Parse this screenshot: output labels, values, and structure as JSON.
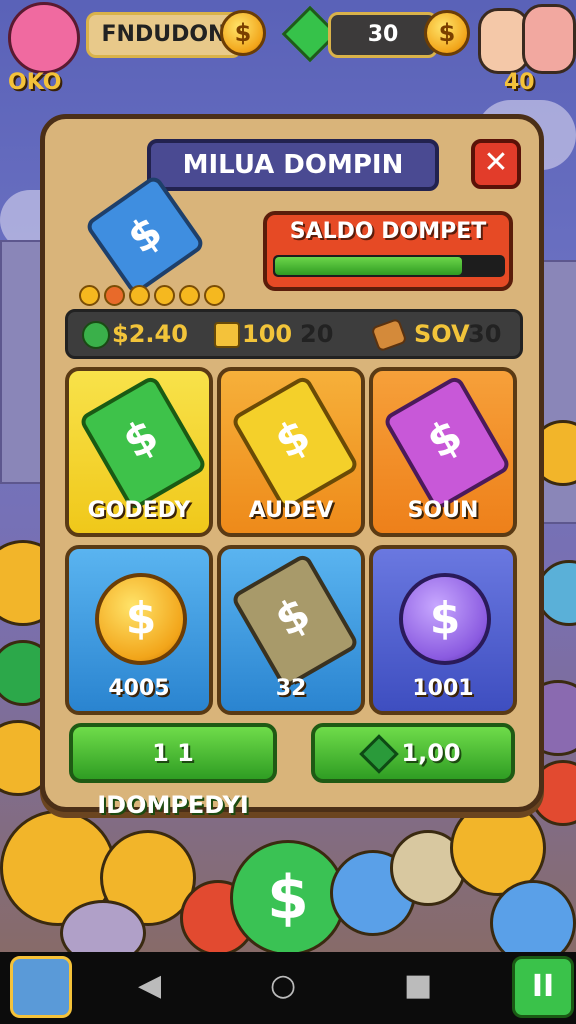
{
  "hud": {
    "player_name": "FNDUDON",
    "currency_symbol": "$",
    "gem_count": "30",
    "sub_left": "OKO",
    "sub_right": "40"
  },
  "panel": {
    "title": "MILUA DOMPIN",
    "close_symbol": "✕",
    "balance_label": "SALDO DOMPET",
    "balance_fill": 0.82,
    "stats": {
      "cash": "$2.40",
      "gold": "100",
      "gold_extra": "20",
      "silver": "SOV",
      "silver_extra": "30"
    },
    "cards": [
      {
        "label": "GODEDY",
        "color": "#f4d32a",
        "icon": "green-dollar-wallet-icon"
      },
      {
        "label": "AUDEV",
        "color": "#f29a22",
        "icon": "yellow-dollar-wallet-icon"
      },
      {
        "label": "SOUN",
        "color": "#f08a20",
        "icon": "purple-dollar-wallet-icon"
      },
      {
        "label": "4005",
        "color": "#3a9de0",
        "icon": "gold-coin-icon"
      },
      {
        "label": "32",
        "color": "#3a9de0",
        "icon": "brown-dollar-wallet-icon"
      },
      {
        "label": "1001",
        "color": "#4a5ad0",
        "icon": "purple-coin-icon"
      }
    ],
    "left_button": "1 1 IDOMPEDYI",
    "right_button": "1,00",
    "card_symbol": "$"
  }
}
